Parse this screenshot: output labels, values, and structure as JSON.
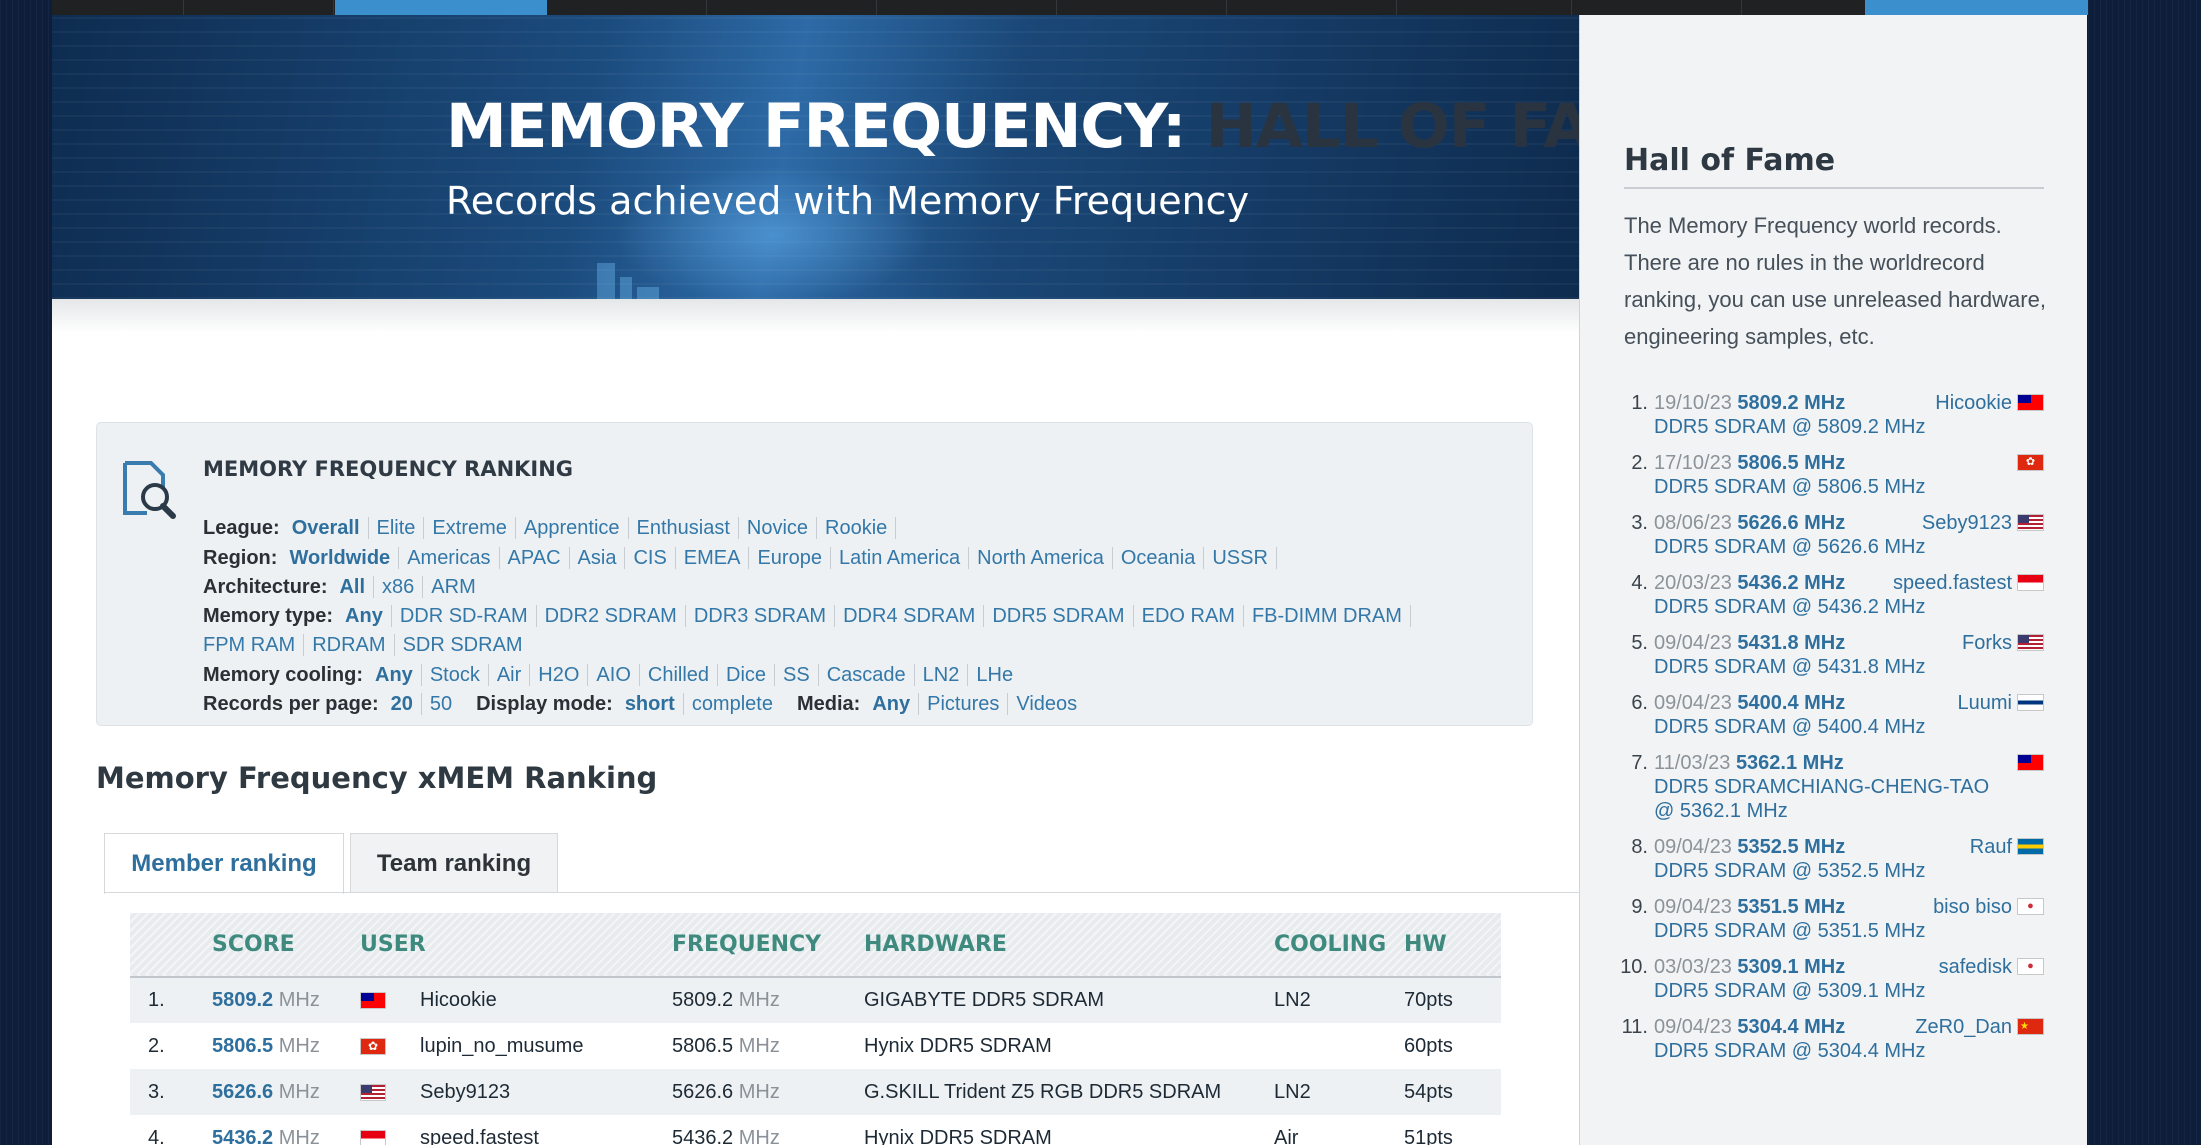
{
  "banner": {
    "title_main": "MEMORY FREQUENCY:",
    "title_accent": "HALL OF FAME",
    "subtitle": "Records achieved with Memory Frequency"
  },
  "filters": {
    "title": "MEMORY FREQUENCY RANKING",
    "league": {
      "label": "League:",
      "options": [
        "Overall",
        "Elite",
        "Extreme",
        "Apprentice",
        "Enthusiast",
        "Novice",
        "Rookie"
      ]
    },
    "region": {
      "label": "Region:",
      "options": [
        "Worldwide",
        "Americas",
        "APAC",
        "Asia",
        "CIS",
        "EMEA",
        "Europe",
        "Latin America",
        "North America",
        "Oceania",
        "USSR"
      ]
    },
    "architecture": {
      "label": "Architecture:",
      "options": [
        "All",
        "x86",
        "ARM"
      ]
    },
    "memory_type": {
      "label": "Memory type:",
      "options": [
        "Any",
        "DDR SD-RAM",
        "DDR2 SDRAM",
        "DDR3 SDRAM",
        "DDR4 SDRAM",
        "DDR5 SDRAM",
        "EDO RAM",
        "FB-DIMM DRAM"
      ],
      "options_row2": [
        "FPM RAM",
        "RDRAM",
        "SDR SDRAM"
      ]
    },
    "memory_cooling": {
      "label": "Memory cooling:",
      "options": [
        "Any",
        "Stock",
        "Air",
        "H2O",
        "AIO",
        "Chilled",
        "Dice",
        "SS",
        "Cascade",
        "LN2",
        "LHe"
      ]
    },
    "records_per_page": {
      "label": "Records per page:",
      "options": [
        "20",
        "50"
      ]
    },
    "display_mode": {
      "label": "Display mode:",
      "options": [
        "short",
        "complete"
      ]
    },
    "media": {
      "label": "Media:",
      "options": [
        "Any",
        "Pictures",
        "Videos"
      ]
    }
  },
  "ranking": {
    "section_title": "Memory Frequency xMEM Ranking",
    "tabs": [
      "Member ranking",
      "Team ranking"
    ],
    "columns": [
      "SCORE",
      "USER",
      "FREQUENCY",
      "HARDWARE",
      "COOLING",
      "HW"
    ],
    "unit": "MHz",
    "rows": [
      {
        "rank": "1.",
        "score": "5809.2",
        "flag": "taiwan",
        "user": "Hicookie",
        "frequency": "5809.2",
        "hardware": "GIGABYTE DDR5 SDRAM",
        "cooling": "LN2",
        "hw": "70pts"
      },
      {
        "rank": "2.",
        "score": "5806.5",
        "flag": "hong-kong",
        "user": "lupin_no_musume",
        "frequency": "5806.5",
        "hardware": "Hynix DDR5 SDRAM",
        "cooling": "",
        "hw": "60pts"
      },
      {
        "rank": "3.",
        "score": "5626.6",
        "flag": "usa",
        "user": "Seby9123",
        "frequency": "5626.6",
        "hardware": "G.SKILL Trident Z5 RGB DDR5 SDRAM",
        "cooling": "LN2",
        "hw": "54pts"
      },
      {
        "rank": "4.",
        "score": "5436.2",
        "flag": "indonesia",
        "user": "speed.fastest",
        "frequency": "5436.2",
        "hardware": "Hynix DDR5 SDRAM",
        "cooling": "Air",
        "hw": "51pts"
      }
    ]
  },
  "sidebar": {
    "title": "Hall of Fame",
    "description": "The Memory Frequency world records. There are no rules in the worldrecord ranking, you can use unreleased hardware, engineering samples, etc.",
    "items": [
      {
        "num": "1.",
        "date": "19/10/23",
        "score": "5809.2 MHz",
        "user": "Hicookie",
        "flag": "taiwan",
        "desc": "DDR5 SDRAM @ 5809.2 MHz"
      },
      {
        "num": "2.",
        "date": "17/10/23",
        "score": "5806.5 MHz",
        "user": "lupin_no_musume",
        "flag": "hong-kong",
        "desc": "DDR5 SDRAM @ 5806.5 MHz"
      },
      {
        "num": "3.",
        "date": "08/06/23",
        "score": "5626.6 MHz",
        "user": "Seby9123",
        "flag": "usa",
        "desc": "DDR5 SDRAM @ 5626.6 MHz"
      },
      {
        "num": "4.",
        "date": "20/03/23",
        "score": "5436.2 MHz",
        "user": "speed.fastest",
        "flag": "indonesia",
        "desc": "DDR5 SDRAM @ 5436.2 MHz"
      },
      {
        "num": "5.",
        "date": "09/04/23",
        "score": "5431.8 MHz",
        "user": "Forks",
        "flag": "usa",
        "desc": "DDR5 SDRAM @ 5431.8 MHz"
      },
      {
        "num": "6.",
        "date": "09/04/23",
        "score": "5400.4 MHz",
        "user": "Luumi",
        "flag": "finland",
        "desc": "DDR5 SDRAM @ 5400.4 MHz"
      },
      {
        "num": "7.",
        "date": "11/03/23",
        "score": "5362.1 MHz",
        "user": "CHIANG-CHENG-TAO",
        "flag": "taiwan",
        "desc": "DDR5 SDRAMCHIANG-CHENG-TAO @ 5362.1 MHz"
      },
      {
        "num": "8.",
        "date": "09/04/23",
        "score": "5352.5 MHz",
        "user": "Rauf",
        "flag": "sweden",
        "desc": "DDR5 SDRAM @ 5352.5 MHz"
      },
      {
        "num": "9.",
        "date": "09/04/23",
        "score": "5351.5 MHz",
        "user": "biso biso",
        "flag": "south-korea",
        "desc": "DDR5 SDRAM @ 5351.5 MHz"
      },
      {
        "num": "10.",
        "date": "03/03/23",
        "score": "5309.1 MHz",
        "user": "safedisk",
        "flag": "south-korea",
        "desc": "DDR5 SDRAM @ 5309.1 MHz"
      },
      {
        "num": "11.",
        "date": "09/04/23",
        "score": "5304.4 MHz",
        "user": "ZeR0_Dan",
        "flag": "china",
        "desc": "DDR5 SDRAM @ 5304.4 MHz"
      }
    ]
  },
  "colors": {
    "link": "#3378a8",
    "accent": "#3c8fcd",
    "header_teal": "#3f8a7e"
  }
}
